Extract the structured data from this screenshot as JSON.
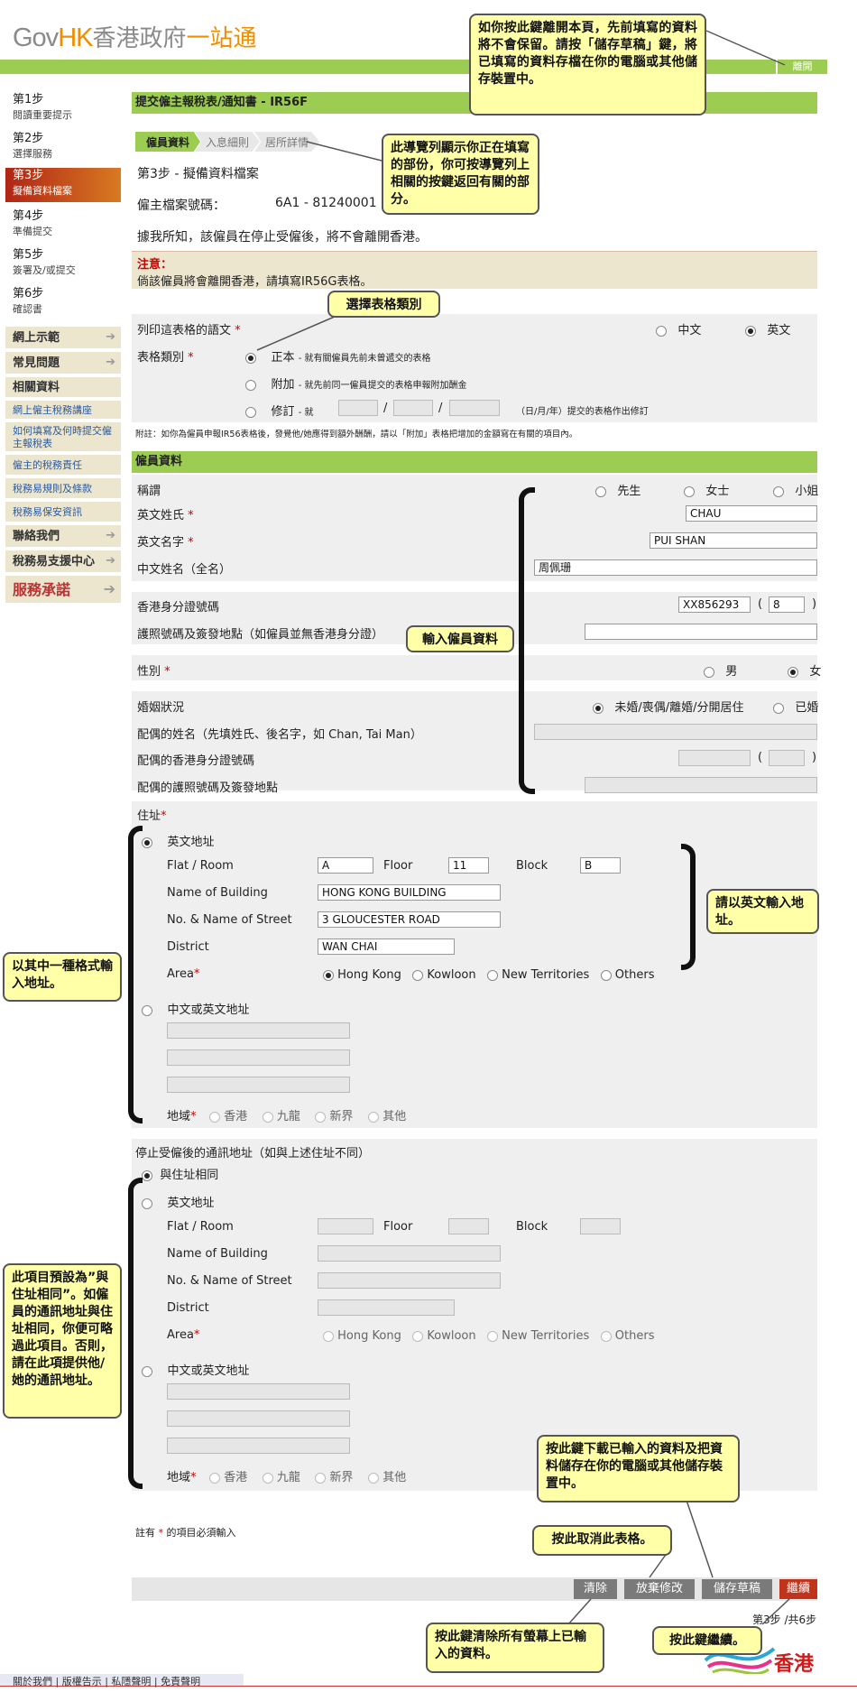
{
  "header": {
    "logo_gov": "Gov",
    "logo_hk": "HK",
    "logo_cn": "香港政府",
    "logo_cn2": "一站通",
    "exit": "離開"
  },
  "sidebar": {
    "steps": [
      {
        "num": "第1步",
        "label": "閱讀重要提示"
      },
      {
        "num": "第2步",
        "label": "選擇服務"
      },
      {
        "num": "第3步",
        "label": "擬備資料檔案"
      },
      {
        "num": "第4步",
        "label": "準備提交"
      },
      {
        "num": "第5步",
        "label": "簽署及/或提交"
      },
      {
        "num": "第6步",
        "label": "確認書"
      }
    ],
    "menu": {
      "online_demo": "網上示範",
      "faq": "常見問題",
      "related": "相關資料",
      "links": [
        "網上僱主稅務講座",
        "如何填寫及何時提交僱主報稅表",
        "僱主的稅務責任",
        "稅務易規則及條款",
        "稅務易保安資訊"
      ],
      "contact": "聯絡我們",
      "support": "稅務易支援中心",
      "service_logo": "服務承諾"
    }
  },
  "form": {
    "title": "提交僱主報稅表/通知書 - IR56F",
    "crumbs": [
      "僱員資料",
      "入息細則",
      "居所詳情"
    ],
    "step_title": "第3步 - 擬備資料檔案",
    "file_no_label": "僱主檔案號碼：",
    "file_no": "6A1 - 81240001",
    "statement": "據我所知，該僱員在停止受僱後，將不會離開香港。",
    "notice_title": "注意：",
    "notice_body": "倘該僱員將會離開香港，請填寫IR56G表格。",
    "lang_label": "列印這表格的語文",
    "lang_zh": "中文",
    "lang_en": "英文",
    "type_label": "表格類別",
    "type_orig": "正本",
    "type_orig_desc": "- 就有關僱員先前未曾遞交的表格",
    "type_add": "附加",
    "type_add_desc": "- 就先前同一僱員提交的表格申報附加酬金",
    "type_rev": "修訂",
    "type_rev_pre": "- 就",
    "type_rev_post": "（日/月/年）提交的表格作出修訂",
    "footnote": "附註：如你為僱員申報IR56表格後，發覺他/她應得到額外酬酬，請以「附加」表格把增加的金額寫在有關的項目內。",
    "emp_section": "僱員資料",
    "title_label": "稱謂",
    "mr": "先生",
    "mrs": "女士",
    "miss": "小姐",
    "surname_label": "英文姓氏",
    "surname": "CHAU",
    "given_label": "英文名字",
    "given": "PUI SHAN",
    "cname_label": "中文姓名（全名）",
    "cname": "周佩珊",
    "hkid_label": "香港身分證號碼",
    "hkid": "XX856293",
    "hkid_check": "8",
    "passport_label": "護照號碼及簽發地點（如僱員並無香港身分證）",
    "sex_label": "性別",
    "male": "男",
    "female": "女",
    "marital_label": "婚姻狀況",
    "marital_single": "未婚/喪偶/離婚/分開居住",
    "marital_married": "已婚",
    "spouse_name_label": "配偶的姓名（先填姓氏、後名字，如 Chan, Tai Man）",
    "spouse_id_label": "配偶的香港身分證號碼",
    "spouse_pp_label": "配偶的護照號碼及簽發地點",
    "addr_label": "住址",
    "eng_addr": "英文地址",
    "flat": "Flat / Room",
    "floor": "Floor",
    "block": "Block",
    "flat_val": "A",
    "floor_val": "11",
    "block_val": "B",
    "building": "Name of Building",
    "building_val": "HONG KONG BUILDING",
    "street": "No. & Name of Street",
    "street_val": "3 GLOUCESTER ROAD",
    "district": "District",
    "district_val": "WAN CHAI",
    "area": "Area",
    "areas": [
      "Hong Kong",
      "Kowloon",
      "New Territories",
      "Others"
    ],
    "cn_addr": "中文或英文地址",
    "region": "地域",
    "regions": [
      "香港",
      "九龍",
      "新界",
      "其他"
    ],
    "postal_label": "停止受僱後的通訊地址（如與上述住址不同）",
    "same_addr": "與住址相同",
    "required_note_pre": "註有",
    "required_note_post": "的項目必須輸入",
    "buttons": {
      "clear": "清除",
      "discard": "放棄修改",
      "save": "儲存草稿",
      "next": "繼續"
    },
    "page_step": "第3步 /共6步",
    "hk_logo": "香港"
  },
  "callouts": {
    "exit": "如你按此鍵離開本頁，先前填寫的資料將不會保留。請按「儲存草稿」鍵，將已填寫的資料存檔在你的電腦或其他儲存裝置中。",
    "nav": "此導覽列顯示你正在填寫的部份，你可按導覽列上相關的按鍵返回有關的部分。",
    "type": "選擇表格類別",
    "emp": "輸入僱員資料",
    "eng": "請以英文輸入地址。",
    "format": "以其中一種格式輸入地址。",
    "postal": "此項目預設為”與住址相同”。如僱員的通訊地址與住址相同，你便可略過此項目。否則，請在此項提供他/她的通訊地址。",
    "save": "按此鍵下載已輸入的資料及把資料儲存在你的電腦或其他儲存裝置中。",
    "discard": "按此取消此表格。",
    "clear": "按此鍵清除所有螢幕上已輸入的資料。",
    "next": "按此鍵繼續。"
  },
  "footer": {
    "links": [
      "關於我們",
      "版權告示",
      "私隱聲明",
      "免責聲明"
    ]
  }
}
